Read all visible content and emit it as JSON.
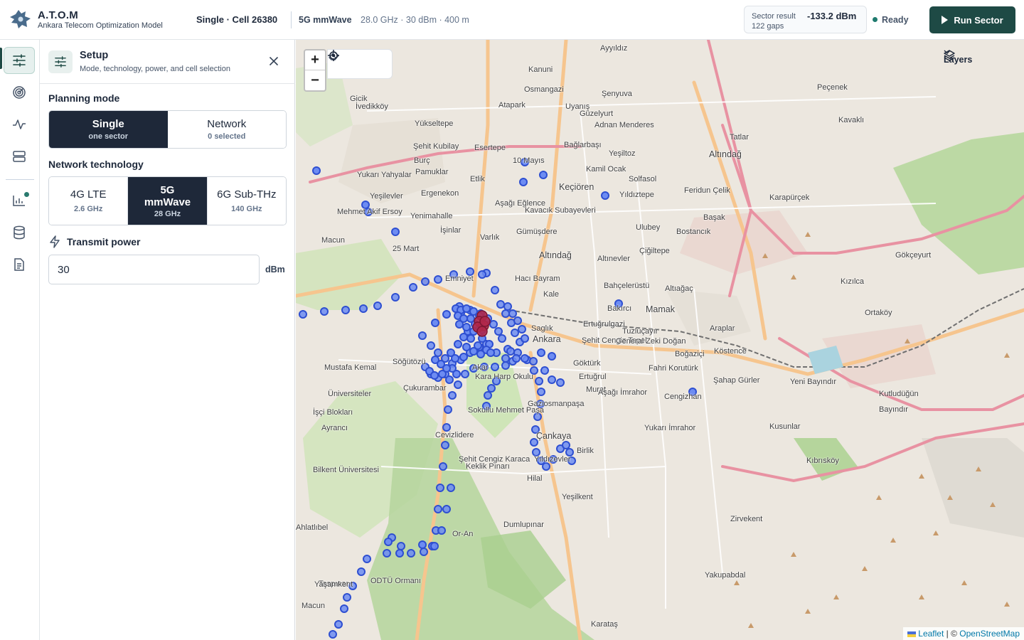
{
  "app": {
    "title": "A.T.O.M",
    "subtitle": "Ankara Telecom Optimization Model"
  },
  "header": {
    "mode_cell": "Single · Cell 26380",
    "tech": "5G mmWave",
    "params": "28.0 GHz · 30 dBm · 400 m",
    "result_label": "Sector result",
    "result_value": "-133.2 dBm",
    "result_gaps": "122 gaps",
    "status": "Ready",
    "run_label": "Run Sector",
    "colors": {
      "accent": "#1e4a45",
      "status": "#1f7a6e"
    }
  },
  "rail": {
    "items": [
      {
        "icon": "sliders-icon",
        "active": true
      },
      {
        "icon": "radar-icon"
      },
      {
        "icon": "pulse-icon"
      },
      {
        "icon": "server-icon"
      },
      {
        "icon": "bar-chart-icon",
        "badge": true
      },
      {
        "icon": "database-icon"
      },
      {
        "icon": "document-icon"
      }
    ]
  },
  "panel": {
    "title": "Setup",
    "subtitle": "Mode, technology, power, and cell selection",
    "planning_mode_label": "Planning mode",
    "modes": [
      {
        "label": "Single",
        "sub": "one sector",
        "selected": true
      },
      {
        "label": "Network",
        "sub": "0 selected",
        "selected": false
      }
    ],
    "tech_label": "Network technology",
    "techs": [
      {
        "label": "4G LTE",
        "sub": "2.6 GHz",
        "selected": false
      },
      {
        "label": "5G mmWave",
        "sub": "28 GHz",
        "selected": true
      },
      {
        "label": "6G Sub-THz",
        "sub": "140 GHz",
        "selected": false
      }
    ],
    "power_label": "Transmit power",
    "power_value": "30",
    "power_unit": "dBm"
  },
  "map": {
    "zoom_in": "+",
    "zoom_out": "−",
    "layers_label": "Layers",
    "attribution_leaflet": "Leaflet",
    "attribution_sep": " | © ",
    "attribution_osm": "OpenStreetMap",
    "labels": [
      "Ayyıldız",
      "Kanuni",
      "Osmangazi",
      "Şenyuva",
      "Atapark",
      "Uyanış",
      "Güzelyurt",
      "Adnan Menderes",
      "İvedikköy",
      "Yükseltepe",
      "Şehit Kubilay",
      "Esertepe",
      "Bağlarbaşı",
      "Yeşiltoz",
      "Burç",
      "Pamuklar",
      "10 Mayıs",
      "Kamil Ocak",
      "Keçiören",
      "Solfasol",
      "Yıldıztepe",
      "Feridun Çelik",
      "Yukarı Yahyalar",
      "Yeşilevler",
      "Ergenekon",
      "Etlik",
      "Aşağı Eğlence",
      "Kavacık Subayevleri",
      "Başak",
      "Bostancık",
      "Mehmet Akif Ersoy",
      "Yenimahalle",
      "Macun",
      "İşinlar",
      "25 Mart",
      "Varlık",
      "Gümüşdere",
      "Ulubey",
      "Altındağ",
      "Altınevler",
      "Çiğiltepe",
      "Emniyet",
      "Hacı Bayram",
      "Kale",
      "Bahçelerüstü",
      "Altıağaç",
      "Mamak",
      "Bakırcı",
      "Tuzluçayır",
      "Ankara",
      "Saglık",
      "Ertuğrulgazi",
      "Şehit Cengiz Topel",
      "General Zeki Doğan",
      "Boğaziçi",
      "Araplar",
      "Köstence",
      "Mustafa Kemal",
      "Söğütözü",
      "Akar",
      "Kara Harp Okulu",
      "Göktürk",
      "Ertuğrul",
      "Fahri Korutürk",
      "Şahap Gürler",
      "Yeni Bayındır",
      "Üniversiteler",
      "Çukurambar",
      "Murat",
      "Aşağı İmrahor",
      "Cengizhan",
      "Kutludüğün",
      "İşçi Blokları",
      "Sokullu Mehmet Paşa",
      "Gaziosmanpaşa",
      "Bayındır",
      "Kusunlar",
      "Yukarı İmrahor",
      "Çankaya",
      "Birlik",
      "Cevizlidere",
      "Şehit Cengiz Karaca",
      "Yıldızevler",
      "Kıbrısköy",
      "Bilkent Üniversitesi",
      "Keklik Pınarı",
      "Hilal",
      "Yeşilkent",
      "Zirvekent",
      "Dumlupınar",
      "Or-An",
      "Yakupabdal",
      "Taspınar",
      "ODTÜ Ormanı",
      "Karataş",
      "Gicik",
      "Peçenek",
      "Kavaklı",
      "Tatlar",
      "Altındağ",
      "Karapürçek",
      "Gökçeyurt",
      "Kızılca",
      "Ortaköy",
      "Ahlatlıbel",
      "Macun",
      "Yaşamkent",
      "Ayrancı",
      "Çayyolu"
    ]
  }
}
